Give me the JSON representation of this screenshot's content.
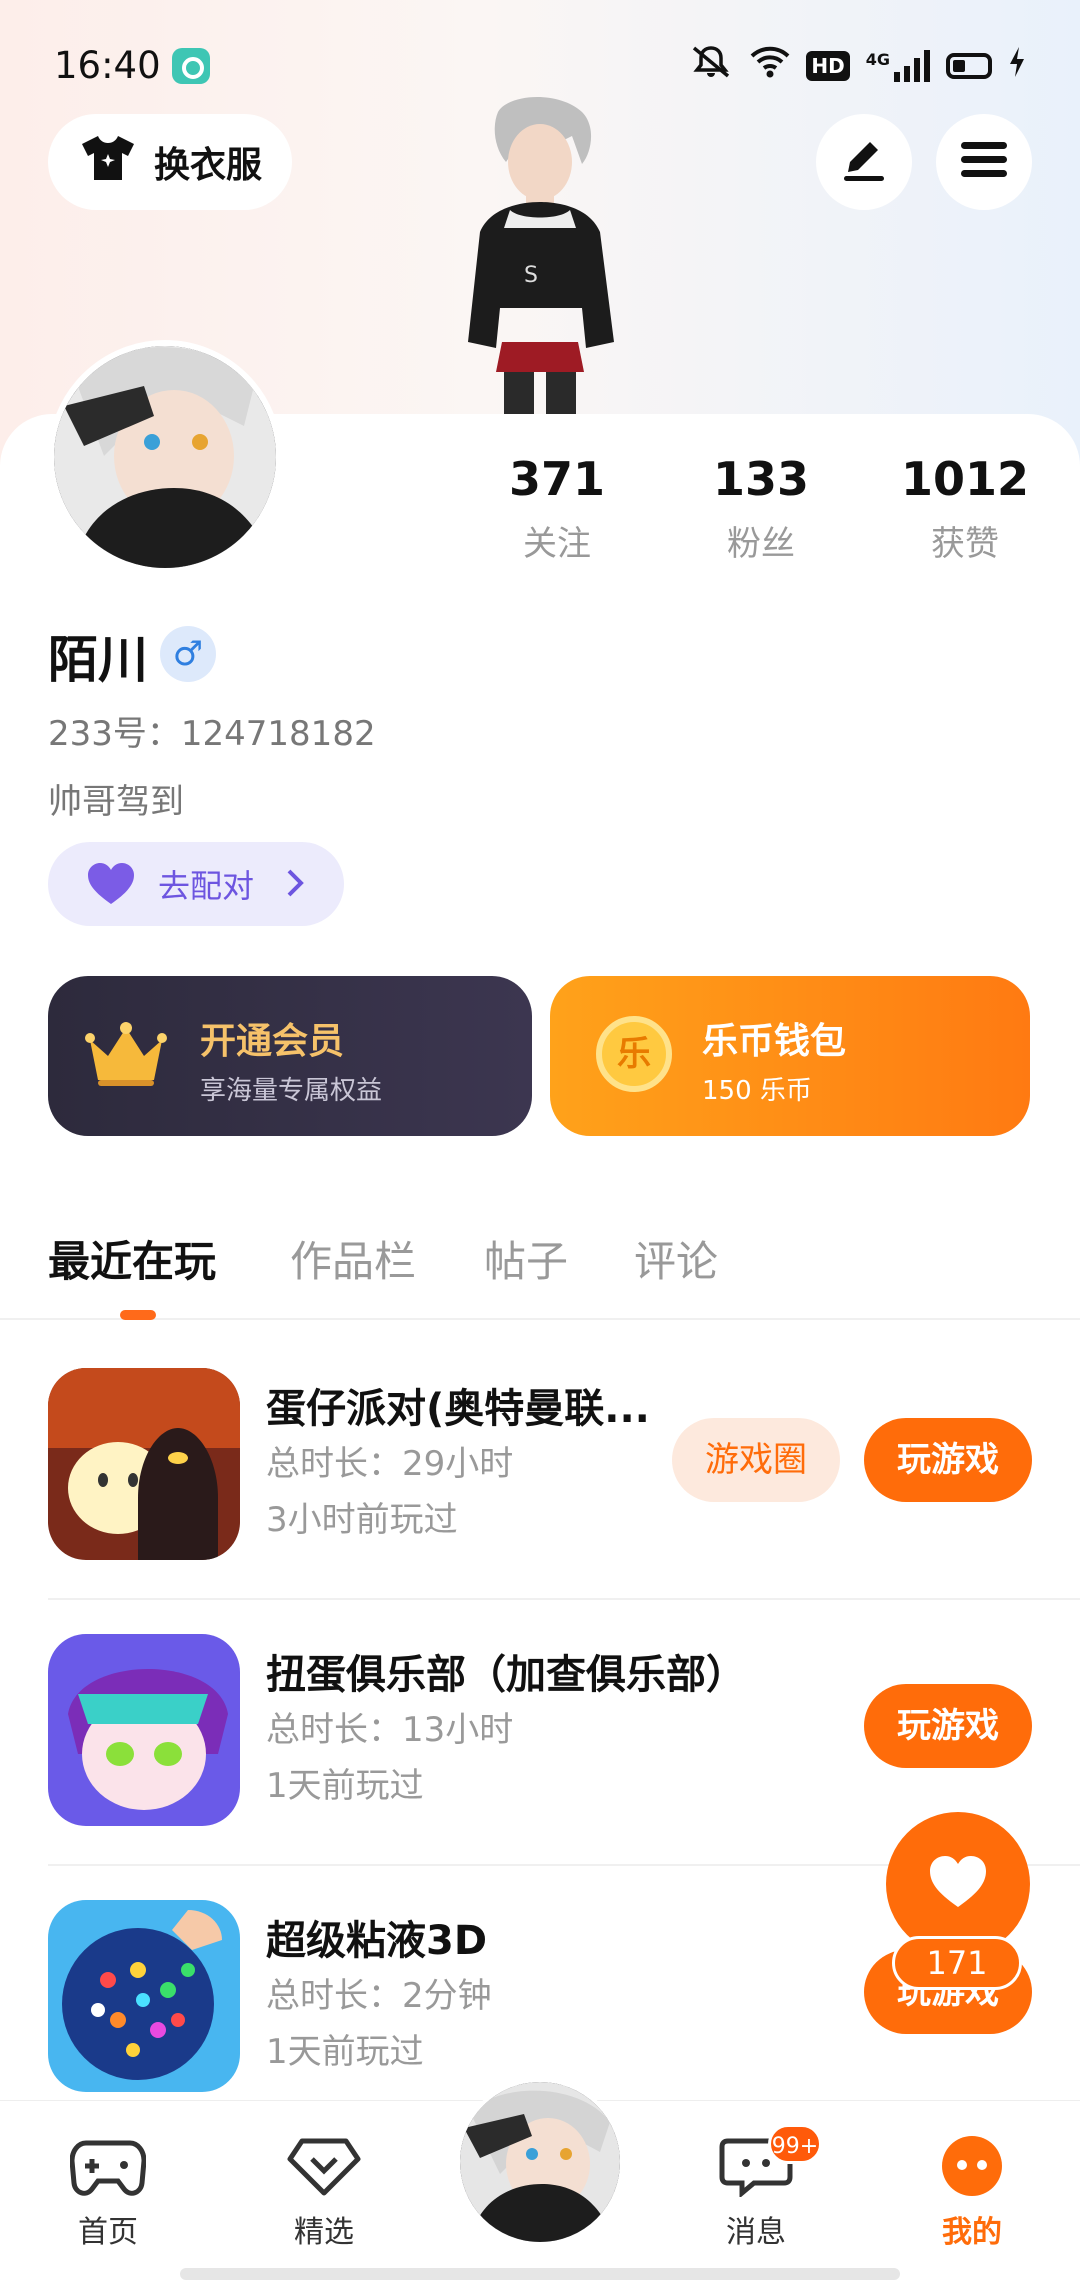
{
  "status_bar": {
    "time": "16:40",
    "hd": "HD",
    "net": "4G"
  },
  "header": {
    "change_outfit_label": "换衣服"
  },
  "stats": [
    {
      "value": "371",
      "label": "关注"
    },
    {
      "value": "133",
      "label": "粉丝"
    },
    {
      "value": "1012",
      "label": "获赞"
    }
  ],
  "profile": {
    "name": "陌川",
    "gender_symbol": "♂",
    "uid": "233号：124718182",
    "bio": "帅哥驾到",
    "match_label": "去配对"
  },
  "cards": {
    "vip": {
      "title": "开通会员",
      "subtitle": "享海量专属权益"
    },
    "wallet": {
      "title": "乐币钱包",
      "subtitle": "150 乐币",
      "coin_char": "乐"
    }
  },
  "tabs": [
    "最近在玩",
    "作品栏",
    "帖子",
    "评论"
  ],
  "games": [
    {
      "title": "蛋仔派对(奥特曼联...",
      "duration": "总时长：29小时",
      "last_played": "3小时前玩过",
      "circle_label": "游戏圈",
      "play_label": "玩游戏"
    },
    {
      "title": "扭蛋俱乐部（加查俱乐部）",
      "duration": "总时长：13小时",
      "last_played": "1天前玩过",
      "play_label": "玩游戏"
    },
    {
      "title": "超级粘液3D",
      "duration": "总时长：2分钟",
      "last_played": "1天前玩过",
      "play_label": "玩游戏"
    }
  ],
  "fab": {
    "count": "171"
  },
  "nav": {
    "home": "首页",
    "featured": "精选",
    "messages": "消息",
    "messages_badge": "99+",
    "mine": "我的"
  },
  "colors": {
    "accent": "#ff6c0a",
    "vip_bg": "#2d2a3c",
    "match_purple": "#6d55e0"
  }
}
